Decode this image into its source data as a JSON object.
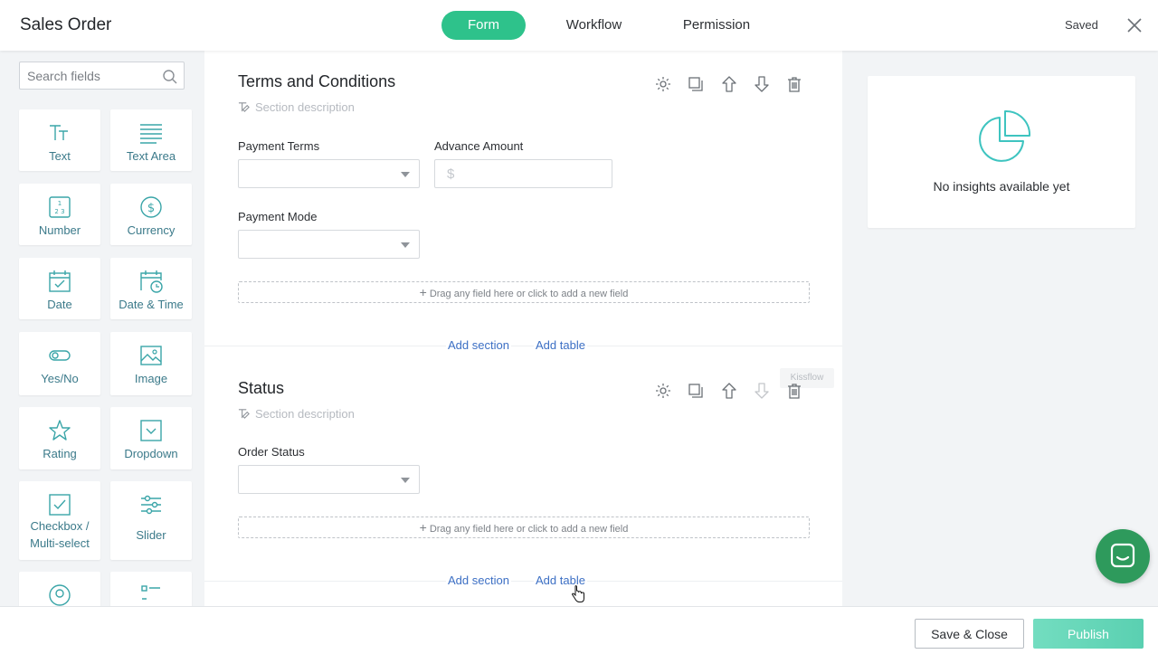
{
  "header": {
    "title": "Sales Order",
    "tabs": [
      {
        "label": "Form",
        "active": true
      },
      {
        "label": "Workflow",
        "active": false
      },
      {
        "label": "Permission",
        "active": false
      }
    ],
    "status": "Saved"
  },
  "left_panel": {
    "search_placeholder": "Search fields",
    "fields": [
      {
        "label": "Text",
        "icon": "text-icon"
      },
      {
        "label": "Text Area",
        "icon": "text-area-icon"
      },
      {
        "label": "Number",
        "icon": "number-icon"
      },
      {
        "label": "Currency",
        "icon": "currency-icon"
      },
      {
        "label": "Date",
        "icon": "date-icon"
      },
      {
        "label": "Date & Time",
        "icon": "date-time-icon"
      },
      {
        "label": "Yes/No",
        "icon": "toggle-icon"
      },
      {
        "label": "Image",
        "icon": "image-icon"
      },
      {
        "label": "Rating",
        "icon": "star-icon"
      },
      {
        "label": "Dropdown",
        "icon": "dropdown-icon"
      },
      {
        "label": "Checkbox / Multi-select",
        "icon": "checkbox-icon"
      },
      {
        "label": "Slider",
        "icon": "slider-icon"
      },
      {
        "label": "",
        "icon": "user-icon"
      },
      {
        "label": "",
        "icon": "list-icon"
      }
    ]
  },
  "form": {
    "sections": [
      {
        "title": "Terms and Conditions",
        "description_placeholder": "Section description",
        "fields": [
          {
            "label": "Payment Terms",
            "type": "dropdown",
            "value": ""
          },
          {
            "label": "Advance Amount",
            "type": "currency",
            "currency_symbol": "$",
            "value": ""
          },
          {
            "label": "Payment Mode",
            "type": "dropdown",
            "value": ""
          }
        ],
        "dropzone_text": "Drag any field here or click to add a new field"
      },
      {
        "title": "Status",
        "description_placeholder": "Section description",
        "fields": [
          {
            "label": "Order Status",
            "type": "dropdown",
            "value": ""
          }
        ],
        "dropzone_text": "Drag any field here or click to add a new field"
      }
    ],
    "add_section_label": "Add section",
    "add_table_label": "Add table",
    "watermark": "Kissflow"
  },
  "insights": {
    "empty_text": "No insights available yet",
    "accent": "#3ec4c0"
  },
  "footer": {
    "save_close_label": "Save & Close",
    "publish_label": "Publish"
  },
  "colors": {
    "accent_green": "#2ec28b",
    "link_blue": "#3c6fc4",
    "tile_text": "#3b7a8a",
    "chat_green": "#2e9a5c"
  }
}
